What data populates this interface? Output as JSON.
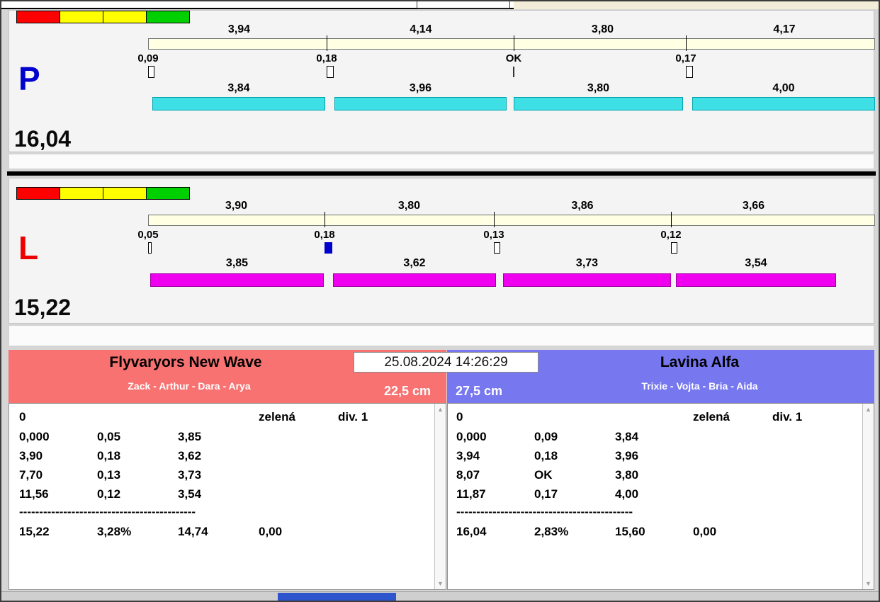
{
  "datetime": "25.08.2024 14:26:29",
  "lanes": [
    {
      "id": "right-lane",
      "label": "P",
      "label_color": "#0000cf",
      "bar_color": "#3fdfe6",
      "total": "16,04",
      "splits": [
        "3,94",
        "4,14",
        "3,80",
        "4,17"
      ],
      "changes": [
        "0,09",
        "0,18",
        "OK",
        "0,17"
      ],
      "change_marker_states": [
        "outline",
        "outline",
        "line",
        "outline"
      ],
      "legs": [
        "3,84",
        "3,96",
        "3,80",
        "4,00"
      ]
    },
    {
      "id": "left-lane",
      "label": "L",
      "label_color": "#ee0000",
      "bar_color": "#ef00ef",
      "total": "15,22",
      "splits": [
        "3,90",
        "3,80",
        "3,86",
        "3,66"
      ],
      "changes": [
        "0,05",
        "0,18",
        "0,13",
        "0,12"
      ],
      "change_marker_states": [
        "outline",
        "filled",
        "outline",
        "outline"
      ],
      "legs": [
        "3,85",
        "3,62",
        "3,73",
        "3,54"
      ]
    }
  ],
  "traffic_light_colors": [
    "#ff0000",
    "#ffff00",
    "#ffff00",
    "#00cf00"
  ],
  "teams": [
    {
      "name": "Flyvaryors New Wave",
      "members": "Zack - Arthur - Dara - Arya",
      "jump_height": "22,5 cm",
      "header_color": "#f87272",
      "result": {
        "flag": "0",
        "light": "zelená",
        "division": "div. 1",
        "rows": [
          [
            "0,000",
            "0,05",
            "3,85"
          ],
          [
            "3,90",
            "0,18",
            "3,62"
          ],
          [
            "7,70",
            "0,13",
            "3,73"
          ],
          [
            "11,56",
            "0,12",
            "3,54"
          ]
        ],
        "separator": "--------------------------------------------",
        "summary": [
          "15,22",
          "3,28%",
          "14,74",
          "0,00"
        ]
      }
    },
    {
      "name": "Lavina Alfa",
      "members": "Trixie - Vojta - Bria - Aida",
      "jump_height": "27,5 cm",
      "header_color": "#7777f0",
      "result": {
        "flag": "0",
        "light": "zelená",
        "division": "div. 1",
        "rows": [
          [
            "0,000",
            "0,09",
            "3,84"
          ],
          [
            "3,94",
            "0,18",
            "3,96"
          ],
          [
            "8,07",
            "OK",
            "3,80"
          ],
          [
            "11,87",
            "0,17",
            "4,00"
          ]
        ],
        "separator": "--------------------------------------------",
        "summary": [
          "16,04",
          "2,83%",
          "15,60",
          "0,00"
        ]
      }
    }
  ]
}
